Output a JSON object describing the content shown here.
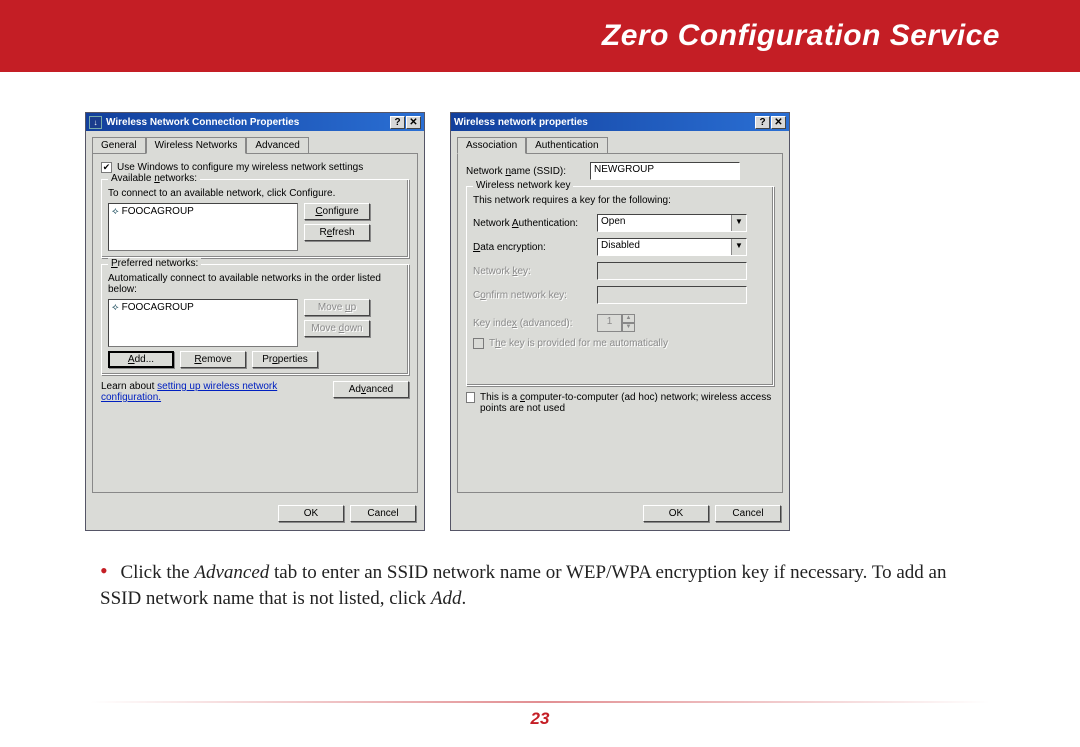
{
  "banner": {
    "title": "Zero Configuration Service"
  },
  "dialog1": {
    "title": "Wireless Network Connection Properties",
    "help_btn": "?",
    "close_btn": "✕",
    "tabs": {
      "general": "General",
      "wireless": "Wireless Networks",
      "advanced": "Advanced"
    },
    "use_windows_chk": "Use Windows to configure my wireless network settings",
    "available": {
      "legend": "Available networks:",
      "hint": "To connect to an available network, click Configure.",
      "item": "FOOCAGROUP",
      "configure": "Configure",
      "refresh": "Refresh"
    },
    "preferred": {
      "legend": "Preferred networks:",
      "hint": "Automatically connect to available networks in the order listed below:",
      "item": "FOOCAGROUP",
      "move_up": "Move up",
      "move_down": "Move down",
      "add": "Add...",
      "remove": "Remove",
      "properties": "Properties"
    },
    "learn_txt": "Learn about ",
    "learn_link": "setting up wireless network configuration.",
    "advanced_btn": "Advanced",
    "ok": "OK",
    "cancel": "Cancel"
  },
  "dialog2": {
    "title": "Wireless network properties",
    "help_btn": "?",
    "close_btn": "✕",
    "tabs": {
      "association": "Association",
      "authentication": "Authentication"
    },
    "ssid_label": "Network name (SSID):",
    "ssid_value": "NEWGROUP",
    "key_legend": "Wireless network key",
    "key_hint": "This network requires a key for the following:",
    "auth_label": "Network Authentication:",
    "auth_value": "Open",
    "enc_label": "Data encryption:",
    "enc_value": "Disabled",
    "netkey_label": "Network key:",
    "confirm_label": "Confirm network key:",
    "keyidx_label": "Key index (advanced):",
    "keyidx_value": "1",
    "auto_chk": "The key is provided for me automatically",
    "adhoc_chk": "This is a computer-to-computer (ad hoc) network; wireless access points are not used",
    "ok": "OK",
    "cancel": "Cancel"
  },
  "instruction": {
    "text_pre": "Click the ",
    "em1": "Advanced",
    "text_mid": " tab to enter an SSID network name or WEP/WPA encryption key if necessary.  To add an SSID network name that is not listed, click ",
    "em2": "Add",
    "text_post": "."
  },
  "page_number": "23"
}
